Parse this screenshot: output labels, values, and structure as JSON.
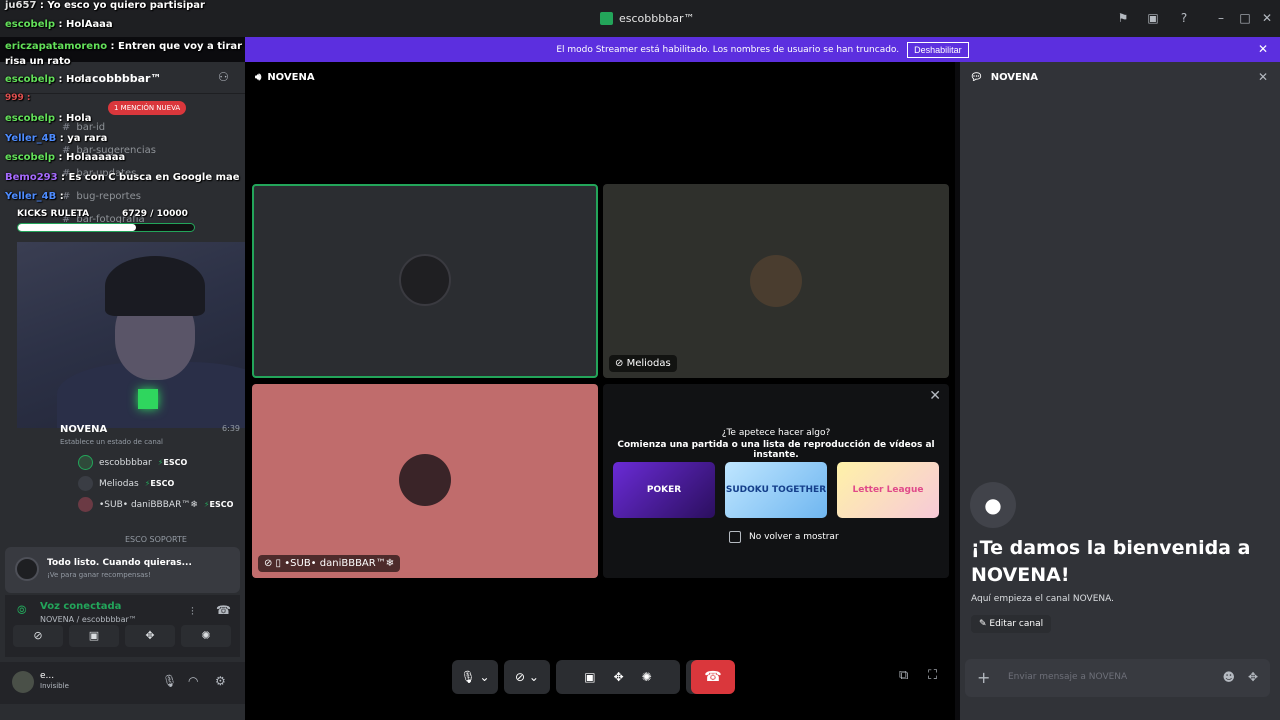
{
  "window": {
    "title": "escobbbbar™"
  },
  "banner": {
    "text": "El modo Streamer está habilitado. Los nombres de usuario se han truncado.",
    "button": "Deshabilitar"
  },
  "chat": [
    {
      "user": "ju657",
      "text": "Yo esco yo quiero partisipar",
      "color": "#e0e0e0"
    },
    {
      "user": "escobelp",
      "text": "HolAaaa",
      "color": "#63e05a"
    },
    {
      "user": "ericzapatamoreno",
      "text": "Entren que voy a tirar risa un rato",
      "color": "#63e05a"
    },
    {
      "user": "escobelp",
      "text": "Hola",
      "color": "#63e05a"
    },
    {
      "user": "Yeller_4B",
      "text": "ya rara",
      "color": "#4e8cff"
    },
    {
      "user": "escobelp",
      "text": "Hola",
      "color": "#63e05a"
    },
    {
      "user": "escobelp",
      "text": "Holaaaaaa",
      "color": "#63e05a"
    },
    {
      "user": "Bemo293",
      "text": "Es con C busca en Google mae",
      "color": "#a66bff"
    },
    {
      "user": "Yeller_4B",
      "text": "",
      "color": "#4e8cff"
    }
  ],
  "kicks": {
    "label": "KICKS RULETA",
    "count": "6729 / 10000"
  },
  "sidebar": {
    "server": "escobbbbar™",
    "mention": "1 MENCIÓN NUEVA",
    "channels": [
      "bar-id",
      "bar-sugerencias",
      "bar-updates",
      "bug-reportes",
      "bar-fotografía"
    ],
    "voice_channel": {
      "name": "NOVENA",
      "time": "6:39",
      "status": "Establece un estado de canal"
    },
    "members": [
      {
        "name": "escobbbbar",
        "tag": "ESCO"
      },
      {
        "name": "Meliodas",
        "tag": "ESCO"
      },
      {
        "name": "•SUB• daniBBBAR™❄",
        "tag": "ESCO"
      }
    ],
    "next_channel": "ESCO SOPORTE"
  },
  "notice": {
    "title": "Todo listo. Cuando quieras...",
    "subtitle": "¡Ve para ganar recompensas!"
  },
  "voice": {
    "status": "Voz conectada",
    "channel": "NOVENA / escobbbbar™"
  },
  "user": {
    "name": "e...",
    "status": "Invisible"
  },
  "stage": {
    "channel": "NOVENA",
    "tiles": [
      {
        "name": ""
      },
      {
        "name": "Meliodas"
      },
      {
        "name": "•SUB• daniBBBAR™❄"
      }
    ]
  },
  "activity": {
    "line1": "¿Te apetece hacer algo?",
    "line2": "Comienza una partida o una lista de reproducción de vídeos al instante.",
    "games": [
      "POKER",
      "SUDOKU TOGETHER",
      "Letter League"
    ],
    "checkbox": "No volver a mostrar"
  },
  "right": {
    "channel": "NOVENA",
    "welcome": "¡Te damos la bienvenida a NOVENA!",
    "sub": "Aquí empieza el canal NOVENA.",
    "edit": "Editar canal",
    "placeholder": "Enviar mensaje a NOVENA"
  },
  "colors": {
    "accent": "#5865f2",
    "streamer": "#5c2fdf",
    "online": "#23a55a",
    "danger": "#da373c"
  }
}
